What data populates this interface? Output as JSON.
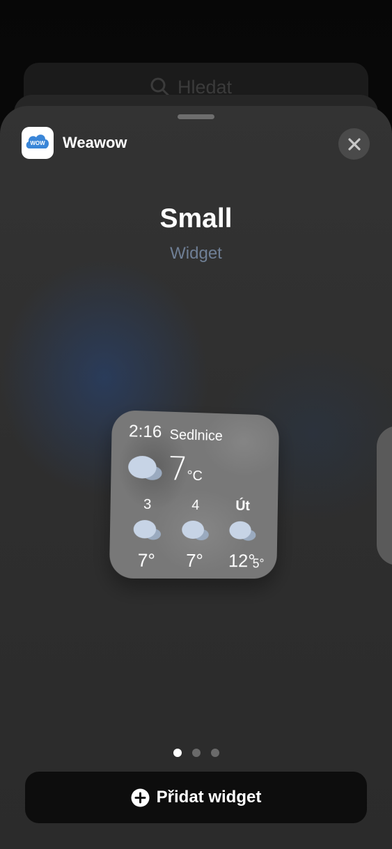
{
  "background": {
    "search_placeholder": "Hledat"
  },
  "header": {
    "app_name": "Weawow",
    "app_icon_text": "WOW"
  },
  "size": {
    "title": "Small",
    "subtitle": "Widget"
  },
  "widget": {
    "time": "2:16",
    "city": "Sedlnice",
    "current_temp": "7",
    "unit": "°C",
    "forecast": [
      {
        "day": "3",
        "temp": "7°",
        "low": ""
      },
      {
        "day": "4",
        "temp": "7°",
        "low": ""
      },
      {
        "day": "Út",
        "temp": "12°",
        "low": "5°"
      }
    ]
  },
  "pager": {
    "count": 3,
    "active": 0
  },
  "add_button": {
    "label": "Přidat widget"
  },
  "colors": {
    "accent_blue": "#3a86d8",
    "cloud_fill": "#c7d4e6",
    "cloud_shade": "#9aaabf"
  }
}
